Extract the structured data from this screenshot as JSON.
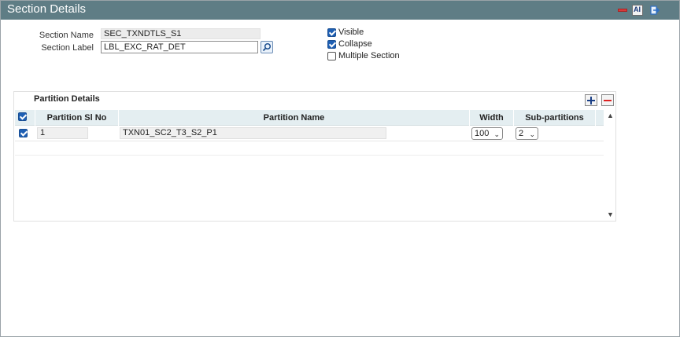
{
  "window": {
    "title": "Section Details"
  },
  "form": {
    "section_name_label": "Section Name",
    "section_name_value": "SEC_TXNDTLS_S1",
    "section_label_label": "Section Label",
    "section_label_value": "LBL_EXC_RAT_DET"
  },
  "options": [
    {
      "label": "Visible",
      "checked": true
    },
    {
      "label": "Collapse",
      "checked": true
    },
    {
      "label": "Multiple Section",
      "checked": false
    }
  ],
  "partition": {
    "title": "Partition Details",
    "columns": [
      "Partition Sl No",
      "Partition Name",
      "Width",
      "Sub-partitions"
    ],
    "rows": [
      {
        "checked": true,
        "sl_no": "1",
        "name": "TXN01_SC2_T3_S2_P1",
        "width": "100",
        "sub_partitions": "2"
      }
    ]
  },
  "icons": {
    "minimize": "minimize-icon",
    "ai": "ai-icon",
    "exit": "exit-icon",
    "lookup": "search-icon",
    "add": "plus-icon",
    "delete": "minus-icon",
    "scroll_up": "chevron-up-icon",
    "scroll_down": "chevron-down-icon"
  },
  "colors": {
    "titlebar": "#5f7d85",
    "checkbox": "#1e5fb3",
    "grid_header": "#e4eef1"
  }
}
